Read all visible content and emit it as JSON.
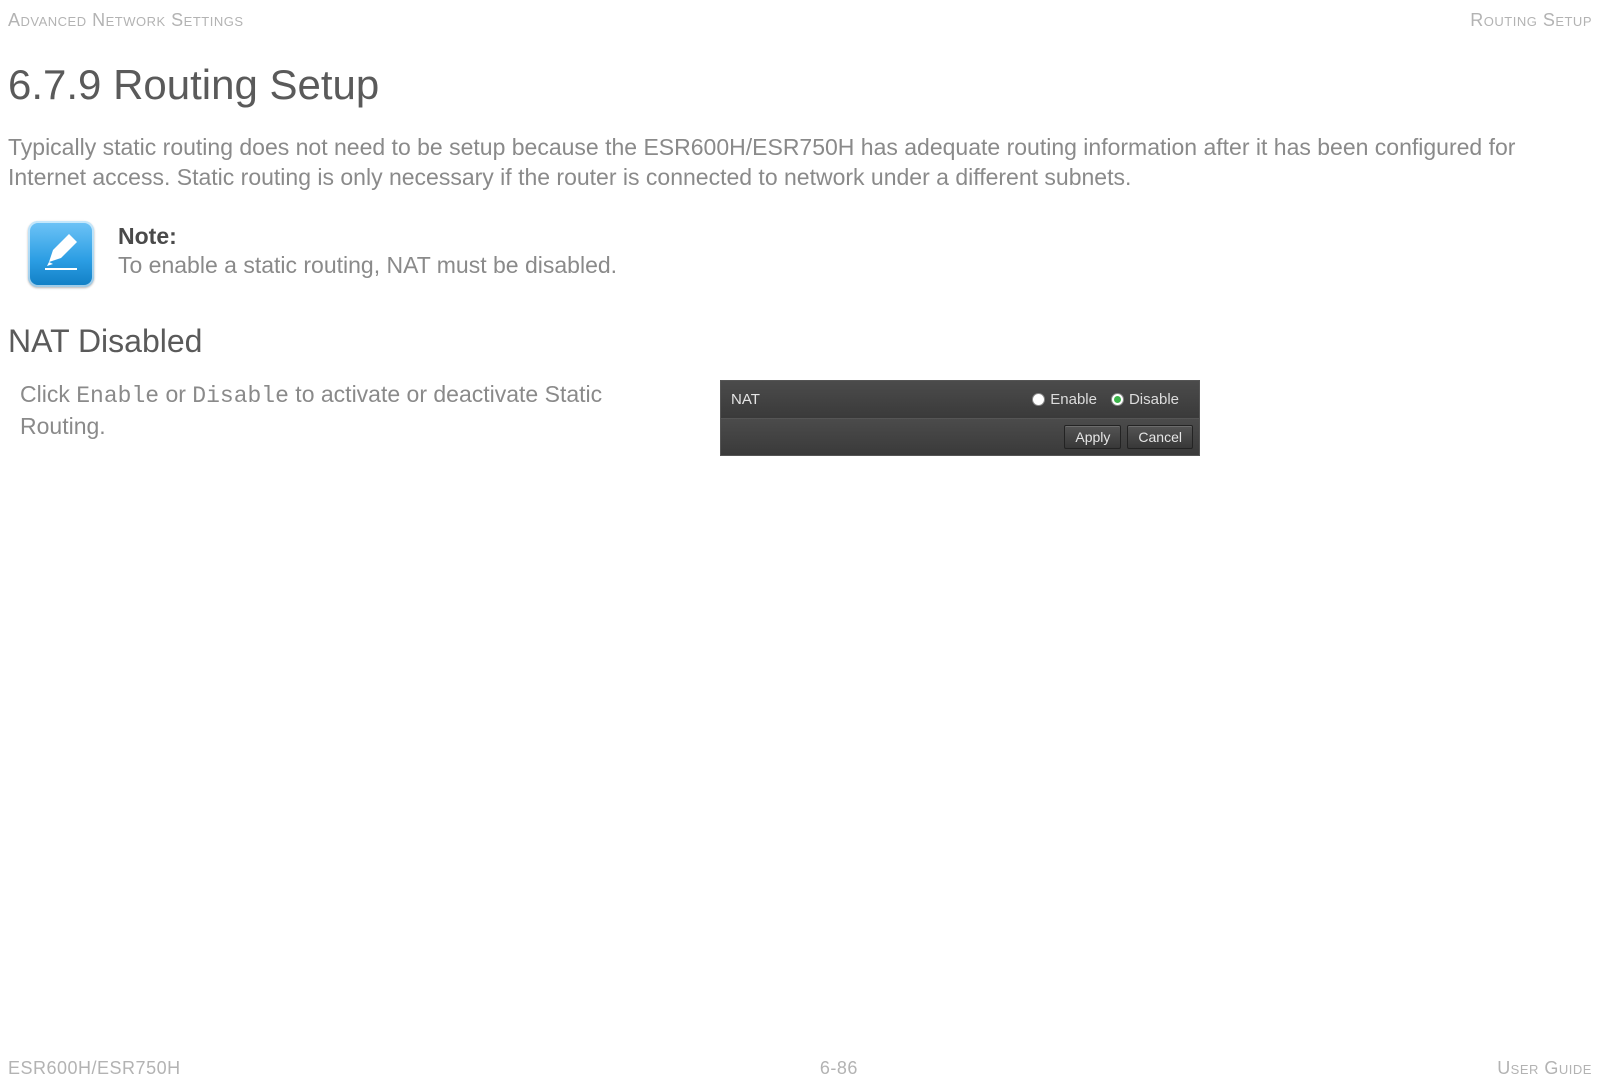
{
  "header": {
    "left": "Advanced Network Settings",
    "right": "Routing Setup"
  },
  "section": {
    "number_title": "6.7.9 Routing Setup",
    "intro": "Typically static routing does not need to be setup because the ESR600H/ESR750H has adequate routing information after it has been configured for Internet access. Static routing is only necessary if the router is connected to network under a different subnets."
  },
  "note": {
    "label": "Note:",
    "body": "To enable a static routing, NAT must be disabled."
  },
  "sub": {
    "title": "NAT Disabled",
    "instruction_pre": "Click ",
    "instruction_enable": "Enable",
    "instruction_mid": " or ",
    "instruction_disable": "Disable",
    "instruction_post": " to activate or deactivate Static Routing."
  },
  "nat_panel": {
    "row_label": "NAT",
    "enable_label": "Enable",
    "disable_label": "Disable",
    "apply_label": "Apply",
    "cancel_label": "Cancel",
    "selected": "Disable"
  },
  "footer": {
    "left": "ESR600H/ESR750H",
    "center": "6-86",
    "right": "User Guide"
  }
}
